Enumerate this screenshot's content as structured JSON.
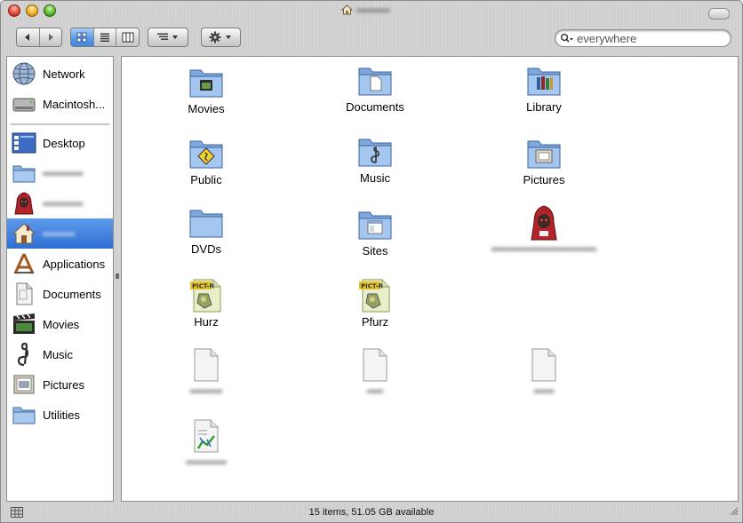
{
  "window": {
    "title": "•••••••••"
  },
  "toolbar": {
    "search_placeholder": "everywhere"
  },
  "sidebar": {
    "items": [
      {
        "label": "Network",
        "icon": "network-icon"
      },
      {
        "label": "Macintosh...",
        "icon": "harddisk-icon"
      },
      {
        "label": "Desktop",
        "icon": "desktop-icon"
      },
      {
        "label": "••••••••••",
        "icon": "folder-icon"
      },
      {
        "label": "••••••••••",
        "icon": "user-avatar-icon"
      },
      {
        "label": "••••••••",
        "icon": "home-icon"
      },
      {
        "label": "Applications",
        "icon": "applications-icon"
      },
      {
        "label": "Documents",
        "icon": "documents-icon"
      },
      {
        "label": "Movies",
        "icon": "movies-icon"
      },
      {
        "label": "Music",
        "icon": "music-icon"
      },
      {
        "label": "Pictures",
        "icon": "pictures-icon"
      },
      {
        "label": "Utilities",
        "icon": "utilities-icon"
      }
    ]
  },
  "files": [
    {
      "label": "Movies",
      "icon": "movies-folder-icon"
    },
    {
      "label": "Documents",
      "icon": "documents-folder-icon"
    },
    {
      "label": "Library",
      "icon": "library-folder-icon"
    },
    {
      "label": "Public",
      "icon": "public-folder-icon"
    },
    {
      "label": "Music",
      "icon": "music-folder-icon"
    },
    {
      "label": "Pictures",
      "icon": "pictures-folder-icon"
    },
    {
      "label": "DVDs",
      "icon": "folder-icon"
    },
    {
      "label": "Sites",
      "icon": "sites-folder-icon"
    },
    {
      "label": "••••••••••••••••••••••••••",
      "icon": "user-avatar-icon"
    },
    {
      "label": "Hurz",
      "icon": "pict-file-icon"
    },
    {
      "label": "Pfurz",
      "icon": "pict-file-icon"
    },
    {
      "label": "••••••••",
      "icon": "document-icon"
    },
    {
      "label": "••••",
      "icon": "document-icon"
    },
    {
      "label": "•••••",
      "icon": "document-icon"
    },
    {
      "label": "••••••••••",
      "icon": "spreadsheet-file-icon"
    }
  ],
  "status": {
    "text": "15 items, 51.05 GB available"
  }
}
